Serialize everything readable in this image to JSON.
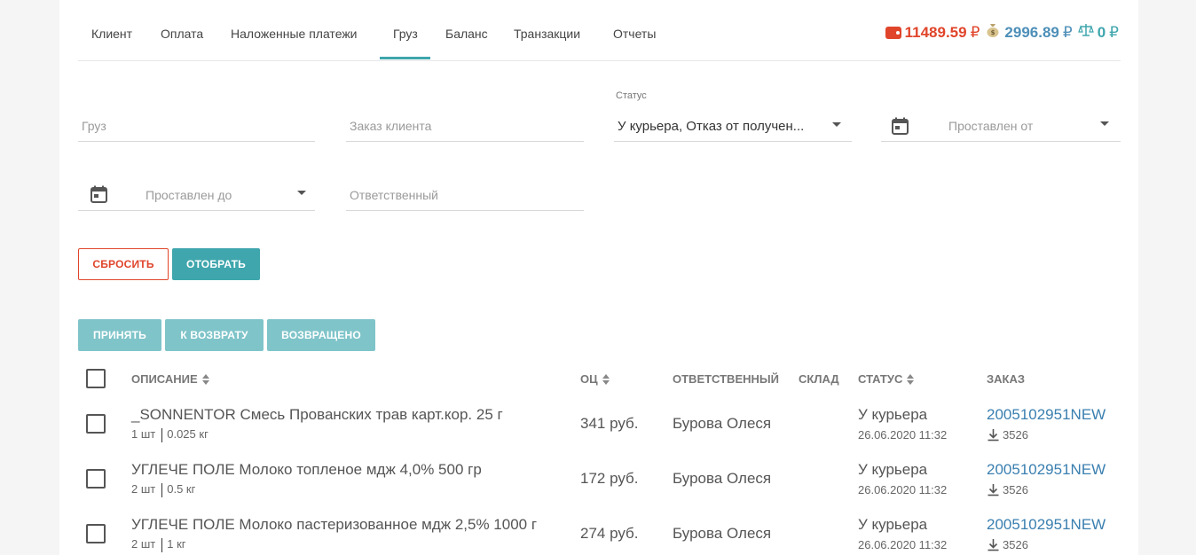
{
  "nav": {
    "tabs": [
      "Клиент",
      "Оплата",
      "Наложенные платежи",
      "Груз",
      "Баланс",
      "Транзакции",
      "Отчеты"
    ],
    "active_tab": "Груз"
  },
  "balance": {
    "wallet": "11489.59",
    "bag": "2996.89",
    "scale": "0",
    "currency": "₽",
    "colors": {
      "wallet": "#e0452b",
      "bag": "#4d8fb8",
      "scale": "#3fa6ad"
    }
  },
  "filters": {
    "cargo_placeholder": "Груз",
    "client_order_placeholder": "Заказ клиента",
    "status_label": "Статус",
    "status_value": "У курьера, Отказ от получен...",
    "date_from_placeholder": "Проставлен от",
    "date_to_placeholder": "Проставлен до",
    "responsible_placeholder": "Ответственный"
  },
  "buttons": {
    "reset": "СБРОСИТЬ",
    "select": "ОТОБРАТЬ",
    "accept": "ПРИНЯТЬ",
    "to_return": "К ВОЗВРАТУ",
    "returned": "ВОЗВРАЩЕНО"
  },
  "table": {
    "headers": {
      "description": "ОПИСАНИЕ",
      "oc": "ОЦ",
      "responsible": "ОТВЕТСТВЕННЫЙ",
      "warehouse": "СКЛАД",
      "status": "СТАТУС",
      "order": "ЗАКАЗ"
    },
    "rows": [
      {
        "description": "_SONNENTOR Смесь Прованских трав карт.кор. 25 г",
        "qty": "1 шт",
        "weight": "0.025 кг",
        "oc": "341 руб.",
        "responsible": "Бурова Олеся",
        "warehouse": "",
        "status": "У курьера",
        "date": "26.06.2020 11:32",
        "order": "2005102951NEW",
        "order_sub": "3526"
      },
      {
        "description": "УГЛЕЧЕ ПОЛЕ Молоко топленое мдж 4,0% 500 гр",
        "qty": "2 шт",
        "weight": "0.5 кг",
        "oc": "172 руб.",
        "responsible": "Бурова Олеся",
        "warehouse": "",
        "status": "У курьера",
        "date": "26.06.2020 11:32",
        "order": "2005102951NEW",
        "order_sub": "3526"
      },
      {
        "description": "УГЛЕЧЕ ПОЛЕ Молоко пастеризованное мдж 2,5% 1000 г",
        "qty": "2 шт",
        "weight": "1 кг",
        "oc": "274 руб.",
        "responsible": "Бурова Олеся",
        "warehouse": "",
        "status": "У курьера",
        "date": "26.06.2020 11:32",
        "order": "2005102951NEW",
        "order_sub": "3526"
      }
    ]
  }
}
